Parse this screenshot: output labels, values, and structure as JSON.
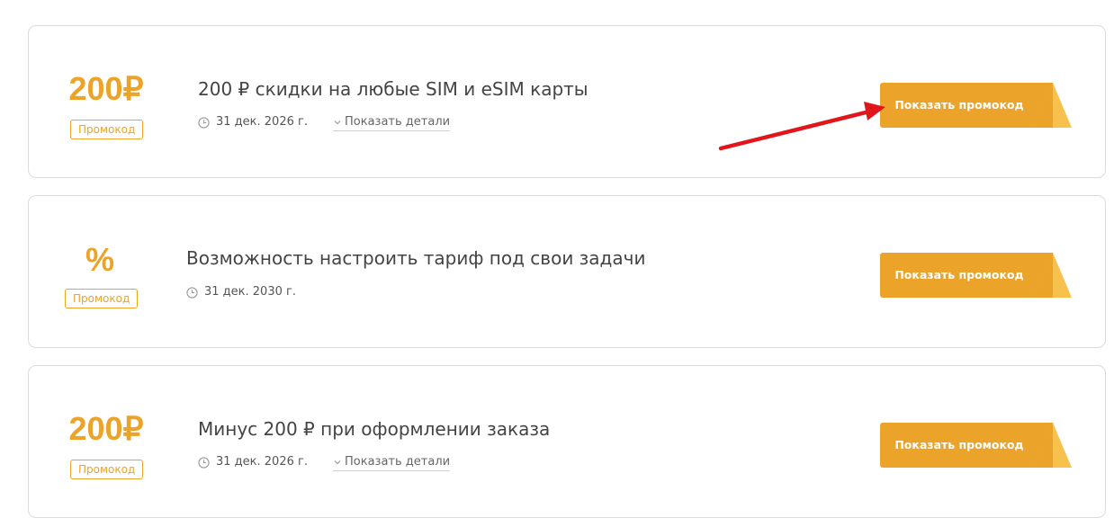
{
  "colors": {
    "accent": "#eba32a",
    "accent_light": "#f8c14e",
    "annotation_arrow": "#e0161b",
    "card_border": "#dcdcdc"
  },
  "offers": [
    {
      "amount": "200₽",
      "badge": "Промокод",
      "title": "200 ₽ скидки на любые SIM и eSIM карты",
      "date": "31 дек. 2026 г.",
      "details_label": "Показать детали",
      "button_label": "Показать промокод"
    },
    {
      "amount": "%",
      "badge": "Промокод",
      "title": "Возможность настроить тариф под свои задачи",
      "date": "31 дек. 2030 г.",
      "button_label": "Показать промокод"
    },
    {
      "amount": "200₽",
      "badge": "Промокод",
      "title": "Минус 200 ₽ при оформлении заказа",
      "date": "31 дек. 2026 г.",
      "details_label": "Показать детали",
      "button_label": "Показать промокод"
    }
  ],
  "icons": {
    "date": "clock-icon",
    "details": "chevron-down-icon",
    "button_corner": "folded-corner-icon"
  }
}
